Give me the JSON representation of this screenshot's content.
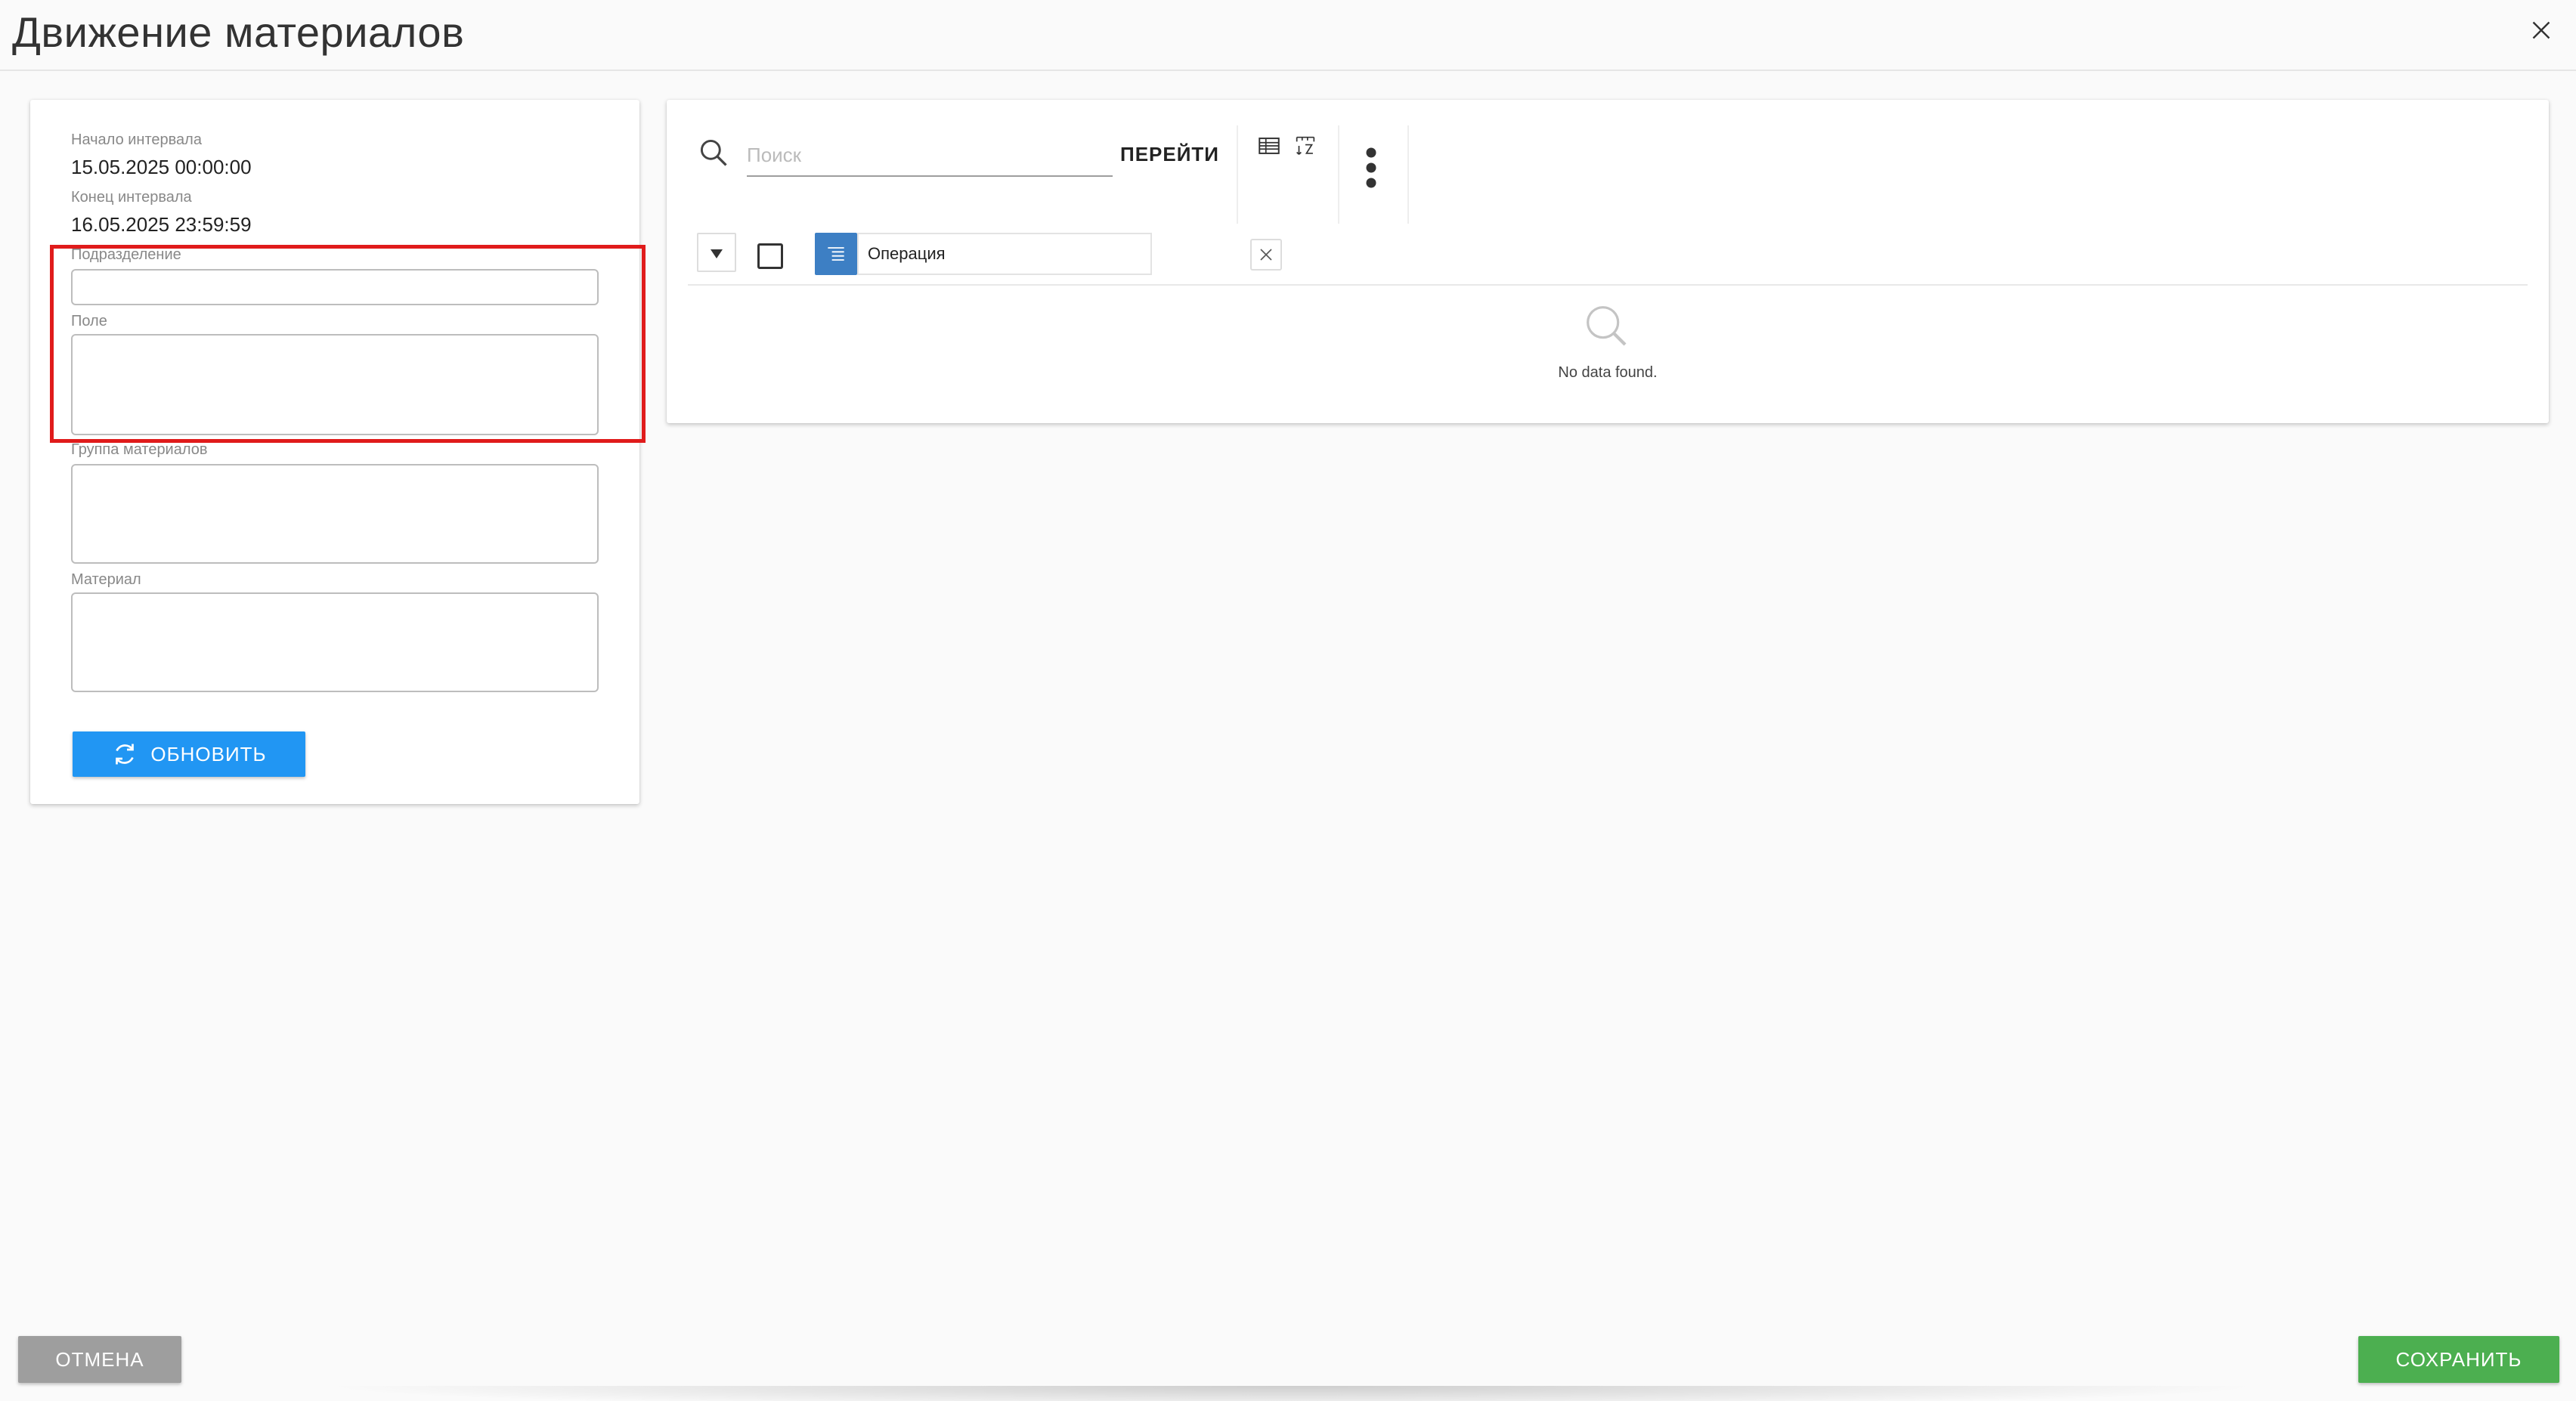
{
  "header": {
    "title": "Движение материалов",
    "close_icon": "close-icon"
  },
  "form": {
    "interval_start": {
      "label": "Начало интервала",
      "value": "15.05.2025 00:00:00"
    },
    "interval_end": {
      "label": "Конец интервала",
      "value": "16.05.2025 23:59:59"
    },
    "division": {
      "label": "Подразделение",
      "value": ""
    },
    "field": {
      "label": "Поле",
      "value": ""
    },
    "material_group": {
      "label": "Группа материалов",
      "value": ""
    },
    "material": {
      "label": "Материал",
      "value": ""
    },
    "refresh_label": "ОБНОВИТЬ"
  },
  "grid": {
    "search": {
      "placeholder": "Поиск",
      "value": ""
    },
    "go_label": "ПЕРЕЙТИ",
    "filter": {
      "column": "Операция",
      "value": ""
    },
    "no_data": "No data found."
  },
  "footer": {
    "cancel_label": "ОТМЕНА",
    "save_label": "СОХРАНИТЬ"
  },
  "colors": {
    "primary": "#2196f3",
    "success": "#4caf50",
    "neutral": "#9e9e9e",
    "highlight": "#e01b1b",
    "filter_icon": "#3d7fc4"
  }
}
